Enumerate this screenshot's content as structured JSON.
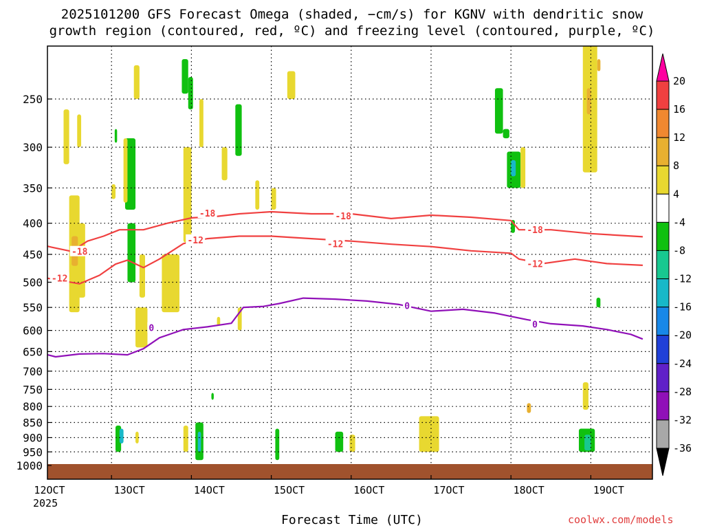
{
  "title_line1": "2025101200 GFS Forecast Omega (shaded, −cm/s) for KGNV with dendritic snow",
  "title_line2": "growth region (contoured, red, ºC) and freezing level (contoured, purple, ºC)",
  "x_axis_title": "Forecast Time (UTC)",
  "credit": "coolwx.com/models",
  "year_label": "2025",
  "chart_data": {
    "type": "heatmap",
    "title": "2025101200 GFS Forecast Omega (shaded, −cm/s) for KGNV with dendritic snow growth region (contoured, red, ºC) and freezing level (contoured, purple, ºC)",
    "xlabel": "Forecast Time (UTC)",
    "ylabel": "",
    "x_ticks": [
      "12OCT",
      "13OCT",
      "14OCT",
      "15OCT",
      "16OCT",
      "17OCT",
      "18OCT",
      "19OCT"
    ],
    "xlim": [
      0,
      7.65
    ],
    "y_scale": "log-pressure",
    "y_ticks": [
      250,
      300,
      350,
      400,
      450,
      500,
      550,
      600,
      650,
      700,
      750,
      800,
      850,
      900,
      950,
      1000
    ],
    "ylim": [
      200,
      1025
    ],
    "grid": true,
    "colorbar": {
      "levels": [
        20,
        16,
        12,
        8,
        4,
        -4,
        -8,
        -12,
        -16,
        -20,
        -24,
        -28,
        -32,
        -36
      ],
      "colors": [
        "#ff00a0",
        "#f04040",
        "#f08830",
        "#e8b030",
        "#e8d830",
        "#ffffff",
        "#10c010",
        "#18c890",
        "#18b8c8",
        "#1888e8",
        "#2040d8",
        "#6020c8",
        "#9010b8",
        "#a8a8a8",
        "#000000"
      ]
    },
    "contours": [
      {
        "name": "-18",
        "color": "#f04040",
        "points": [
          [
            0.0,
            430
          ],
          [
            0.25,
            438
          ],
          [
            0.5,
            445
          ],
          [
            0.7,
            428
          ],
          [
            0.9,
            420
          ],
          [
            1.1,
            410
          ],
          [
            1.4,
            410
          ],
          [
            1.7,
            400
          ],
          [
            2.0,
            392
          ],
          [
            2.3,
            390
          ],
          [
            2.6,
            386
          ],
          [
            3.0,
            383
          ],
          [
            3.5,
            386
          ],
          [
            4.0,
            386
          ],
          [
            4.5,
            393
          ],
          [
            5.0,
            388
          ],
          [
            5.5,
            391
          ],
          [
            6.0,
            396
          ],
          [
            6.1,
            410
          ],
          [
            6.5,
            410
          ],
          [
            7.0,
            416
          ],
          [
            7.65,
            421
          ]
        ]
      },
      {
        "name": "-12",
        "color": "#f04040",
        "points": [
          [
            0.0,
            488
          ],
          [
            0.3,
            495
          ],
          [
            0.6,
            503
          ],
          [
            0.85,
            487
          ],
          [
            1.05,
            467
          ],
          [
            1.2,
            460
          ],
          [
            1.4,
            473
          ],
          [
            1.6,
            458
          ],
          [
            1.9,
            432
          ],
          [
            2.2,
            424
          ],
          [
            2.6,
            420
          ],
          [
            3.0,
            420
          ],
          [
            3.5,
            424
          ],
          [
            4.0,
            428
          ],
          [
            4.5,
            433
          ],
          [
            5.0,
            437
          ],
          [
            5.5,
            444
          ],
          [
            6.0,
            448
          ],
          [
            6.1,
            458
          ],
          [
            6.4,
            466
          ],
          [
            6.8,
            458
          ],
          [
            7.2,
            466
          ],
          [
            7.65,
            469
          ]
        ]
      },
      {
        "name": "0",
        "color": "#9010b8",
        "points": [
          [
            0.0,
            648
          ],
          [
            0.3,
            663
          ],
          [
            0.6,
            656
          ],
          [
            0.9,
            655
          ],
          [
            1.2,
            658
          ],
          [
            1.4,
            643
          ],
          [
            1.6,
            617
          ],
          [
            1.9,
            598
          ],
          [
            2.2,
            592
          ],
          [
            2.5,
            584
          ],
          [
            2.65,
            550
          ],
          [
            2.9,
            548
          ],
          [
            3.1,
            542
          ],
          [
            3.4,
            531
          ],
          [
            3.8,
            533
          ],
          [
            4.2,
            537
          ],
          [
            4.6,
            544
          ],
          [
            5.0,
            558
          ],
          [
            5.4,
            554
          ],
          [
            5.8,
            562
          ],
          [
            6.2,
            576
          ],
          [
            6.5,
            585
          ],
          [
            6.9,
            590
          ],
          [
            7.2,
            598
          ],
          [
            7.5,
            609
          ],
          [
            7.65,
            620
          ]
        ]
      }
    ],
    "contour_labels": [
      {
        "text": "-18",
        "x": 2.2,
        "p": 385,
        "color": "#f04040"
      },
      {
        "text": "-18",
        "x": 3.9,
        "p": 389,
        "color": "#f04040"
      },
      {
        "text": "-18",
        "x": 6.3,
        "p": 410,
        "color": "#f04040"
      },
      {
        "text": "-18",
        "x": 0.6,
        "p": 445,
        "color": "#f04040"
      },
      {
        "text": "-12",
        "x": 2.05,
        "p": 426,
        "color": "#f04040"
      },
      {
        "text": "-12",
        "x": 3.8,
        "p": 432,
        "color": "#f04040"
      },
      {
        "text": "-12",
        "x": 6.3,
        "p": 466,
        "color": "#f04040"
      },
      {
        "text": "-12",
        "x": 0.35,
        "p": 492,
        "color": "#f04040"
      },
      {
        "text": "0",
        "x": 0.1,
        "p": 648,
        "color": "#9010b8"
      },
      {
        "text": "0",
        "x": 1.5,
        "p": 594,
        "color": "#9010b8"
      },
      {
        "text": "0",
        "x": 4.7,
        "p": 546,
        "color": "#9010b8"
      },
      {
        "text": "0",
        "x": 6.3,
        "p": 586,
        "color": "#9010b8"
      }
    ],
    "omega_patches": [
      {
        "x": [
          0.4,
          0.47
        ],
        "p": [
          260,
          320
        ],
        "color": "#e8d830"
      },
      {
        "x": [
          0.47,
          0.6
        ],
        "p": [
          360,
          560
        ],
        "color": "#e8d830"
      },
      {
        "x": [
          0.5,
          0.58
        ],
        "p": [
          420,
          470
        ],
        "color": "#e8b030"
      },
      {
        "x": [
          0.58,
          0.67
        ],
        "p": [
          400,
          530
        ],
        "color": "#e8d830"
      },
      {
        "x": [
          0.57,
          0.62
        ],
        "p": [
          265,
          300
        ],
        "color": "#e8d830"
      },
      {
        "x": [
          1.0,
          1.05
        ],
        "p": [
          345,
          365
        ],
        "color": "#e8d830"
      },
      {
        "x": [
          1.04,
          1.07
        ],
        "p": [
          280,
          295
        ],
        "color": "#10c010"
      },
      {
        "x": [
          1.17,
          1.3
        ],
        "p": [
          290,
          380
        ],
        "color": "#10c010"
      },
      {
        "x": [
          1.15,
          1.2
        ],
        "p": [
          290,
          370
        ],
        "color": "#e8d830"
      },
      {
        "x": [
          1.2,
          1.3
        ],
        "p": [
          400,
          500
        ],
        "color": "#10c010"
      },
      {
        "x": [
          1.28,
          1.35
        ],
        "p": [
          220,
          250
        ],
        "color": "#e8d830"
      },
      {
        "x": [
          1.35,
          1.42
        ],
        "p": [
          450,
          530
        ],
        "color": "#e8d830"
      },
      {
        "x": [
          1.3,
          1.45
        ],
        "p": [
          550,
          640
        ],
        "color": "#e8d830"
      },
      {
        "x": [
          1.63,
          1.85
        ],
        "p": [
          450,
          560
        ],
        "color": "#e8d830"
      },
      {
        "x": [
          1.88,
          1.96
        ],
        "p": [
          215,
          245
        ],
        "color": "#10c010"
      },
      {
        "x": [
          1.96,
          2.02
        ],
        "p": [
          230,
          260
        ],
        "color": "#10c010"
      },
      {
        "x": [
          1.9,
          2.0
        ],
        "p": [
          300,
          430
        ],
        "color": "#e8d830"
      },
      {
        "x": [
          2.1,
          2.15
        ],
        "p": [
          250,
          300
        ],
        "color": "#e8d830"
      },
      {
        "x": [
          2.38,
          2.45
        ],
        "p": [
          300,
          340
        ],
        "color": "#e8d830"
      },
      {
        "x": [
          2.8,
          2.85
        ],
        "p": [
          340,
          380
        ],
        "color": "#e8d830"
      },
      {
        "x": [
          3.0,
          3.06
        ],
        "p": [
          350,
          380
        ],
        "color": "#e8d830"
      },
      {
        "x": [
          3.2,
          3.3
        ],
        "p": [
          225,
          250
        ],
        "color": "#e8d830"
      },
      {
        "x": [
          2.32,
          2.36
        ],
        "p": [
          570,
          590
        ],
        "color": "#e8d830"
      },
      {
        "x": [
          2.58,
          2.63
        ],
        "p": [
          550,
          600
        ],
        "color": "#e8d830"
      },
      {
        "x": [
          2.55,
          2.63
        ],
        "p": [
          255,
          310
        ],
        "color": "#10c010"
      },
      {
        "x": [
          5.8,
          5.9
        ],
        "p": [
          240,
          285
        ],
        "color": "#10c010"
      },
      {
        "x": [
          5.9,
          5.98
        ],
        "p": [
          280,
          290
        ],
        "color": "#10c010"
      },
      {
        "x": [
          5.95,
          6.12
        ],
        "p": [
          305,
          350
        ],
        "color": "#10c010"
      },
      {
        "x": [
          6.0,
          6.06
        ],
        "p": [
          315,
          335
        ],
        "color": "#18b8c8"
      },
      {
        "x": [
          6.12,
          6.18
        ],
        "p": [
          300,
          350
        ],
        "color": "#e8d830"
      },
      {
        "x": [
          6.0,
          6.05
        ],
        "p": [
          395,
          415
        ],
        "color": "#10c010"
      },
      {
        "x": [
          6.9,
          7.08
        ],
        "p": [
          200,
          330
        ],
        "color": "#e8d830"
      },
      {
        "x": [
          6.95,
          7.0
        ],
        "p": [
          240,
          265
        ],
        "color": "#e8b030"
      },
      {
        "x": [
          7.08,
          7.12
        ],
        "p": [
          215,
          225
        ],
        "color": "#e8b030"
      },
      {
        "x": [
          7.07,
          7.12
        ],
        "p": [
          530,
          550
        ],
        "color": "#10c010"
      },
      {
        "x": [
          6.2,
          6.25
        ],
        "p": [
          790,
          820
        ],
        "color": "#e8b030"
      },
      {
        "x": [
          6.9,
          6.97
        ],
        "p": [
          730,
          810
        ],
        "color": "#e8d830"
      },
      {
        "x": [
          1.05,
          1.12
        ],
        "p": [
          860,
          950
        ],
        "color": "#10c010"
      },
      {
        "x": [
          1.1,
          1.15
        ],
        "p": [
          870,
          920
        ],
        "color": "#18b8c8"
      },
      {
        "x": [
          1.3,
          1.34
        ],
        "p": [
          880,
          920
        ],
        "color": "#e8d830"
      },
      {
        "x": [
          1.9,
          1.96
        ],
        "p": [
          860,
          950
        ],
        "color": "#e8d830"
      },
      {
        "x": [
          2.05,
          2.15
        ],
        "p": [
          850,
          980
        ],
        "color": "#10c010"
      },
      {
        "x": [
          2.08,
          2.12
        ],
        "p": [
          880,
          950
        ],
        "color": "#18b8c8"
      },
      {
        "x": [
          2.25,
          2.28
        ],
        "p": [
          760,
          780
        ],
        "color": "#10c010"
      },
      {
        "x": [
          3.05,
          3.1
        ],
        "p": [
          870,
          980
        ],
        "color": "#10c010"
      },
      {
        "x": [
          3.8,
          3.9
        ],
        "p": [
          880,
          950
        ],
        "color": "#10c010"
      },
      {
        "x": [
          3.98,
          4.05
        ],
        "p": [
          890,
          950
        ],
        "color": "#e8d830"
      },
      {
        "x": [
          4.85,
          5.1
        ],
        "p": [
          830,
          950
        ],
        "color": "#e8d830"
      },
      {
        "x": [
          6.85,
          7.05
        ],
        "p": [
          870,
          950
        ],
        "color": "#10c010"
      },
      {
        "x": [
          6.92,
          7.0
        ],
        "p": [
          890,
          945
        ],
        "color": "#18c890"
      }
    ],
    "surface": {
      "p": 1000,
      "color": "#a0522d"
    }
  }
}
